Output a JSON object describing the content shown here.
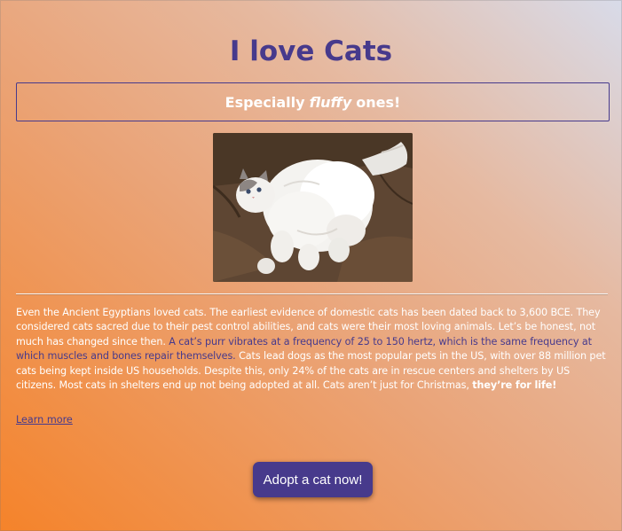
{
  "page": {
    "title": "I love Cats",
    "subtitle_before": "Especially",
    "subtitle_emphasis": "fluffy",
    "subtitle_after": "ones!"
  },
  "image": {
    "alt": "Fluffy white cat"
  },
  "article": {
    "part1": "Even the Ancient Egyptians loved cats. The earliest evidence of domestic cats has been dated back to 3,600 BCE. They considered cats sacred due to their pest control abilities, and cats were their most loving animals. Let’s be honest, not much has changed since then.",
    "part2": "A cat’s purr vibrates at a frequency of 25 to 150 hertz, which is the same frequency at which muscles and bones repair themselves.",
    "part3": "Cats lead dogs as the most popular pets in the US, with over 88 million pet cats being kept inside US households. Despite this, only 24% of the cats are in rescue centers and shelters by US citizens. Most cats in shelters end up not being adopted at all. Cats aren’t just for Christmas,",
    "part4": "they’re for life!"
  },
  "links": {
    "learn_more": "Learn more"
  },
  "actions": {
    "adopt_label": "Adopt a cat now!"
  },
  "colors": {
    "accent": "#473a8c",
    "gradient_start": "#f5832a",
    "gradient_end": "#d8dbe9",
    "text_light": "#ffffff"
  }
}
